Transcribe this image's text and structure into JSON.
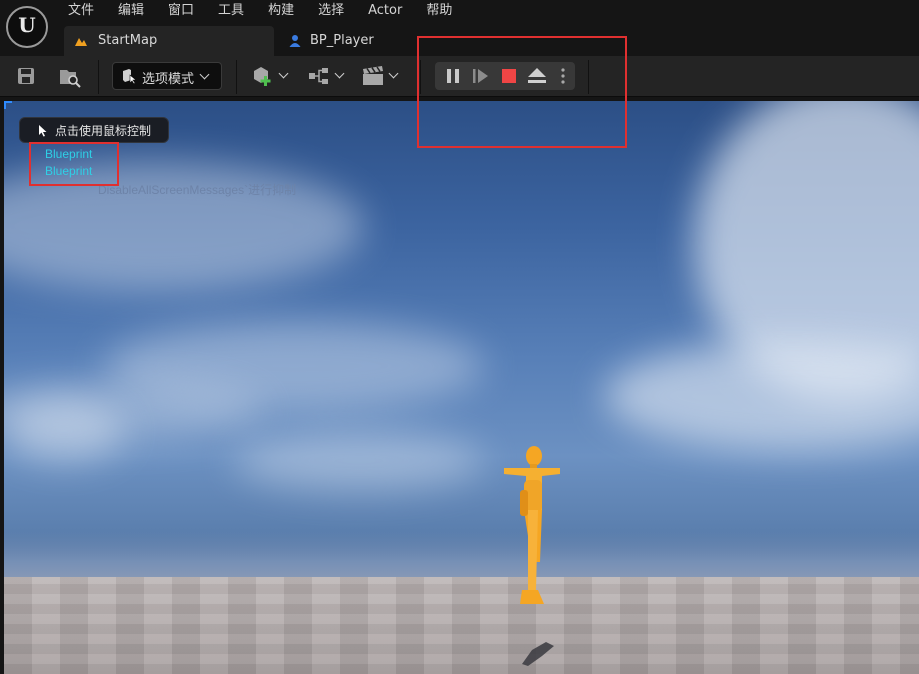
{
  "menu": {
    "items": [
      "文件",
      "编辑",
      "窗口",
      "工具",
      "构建",
      "选择",
      "Actor",
      "帮助"
    ]
  },
  "tabs": [
    {
      "label": "StartMap",
      "icon": "level-map-icon",
      "active": true
    },
    {
      "label": "BP_Player",
      "icon": "blueprint-person-icon",
      "active": false
    }
  ],
  "toolbar": {
    "mode_label": "选项模式",
    "buttons": [
      "save-icon",
      "content-browser-icon",
      "mode-select-icon",
      "add-actor-icon",
      "blueprint-graph-icon",
      "cinematics-icon"
    ],
    "play_controls": [
      "pause-icon",
      "step-frame-icon",
      "stop-icon",
      "eject-icon",
      "more-options-icon"
    ]
  },
  "viewport": {
    "mouse_hint": "点击使用鼠标控制",
    "screen_messages": [
      "Blueprint",
      "Blueprint"
    ],
    "disable_hint": "DisableAllScreenMessages`进行抑制"
  },
  "colors": {
    "accent_red": "#e03030",
    "stop_red": "#f04545",
    "message_cyan": "#2fd0e6",
    "mannequin_orange": "#f5a623"
  }
}
